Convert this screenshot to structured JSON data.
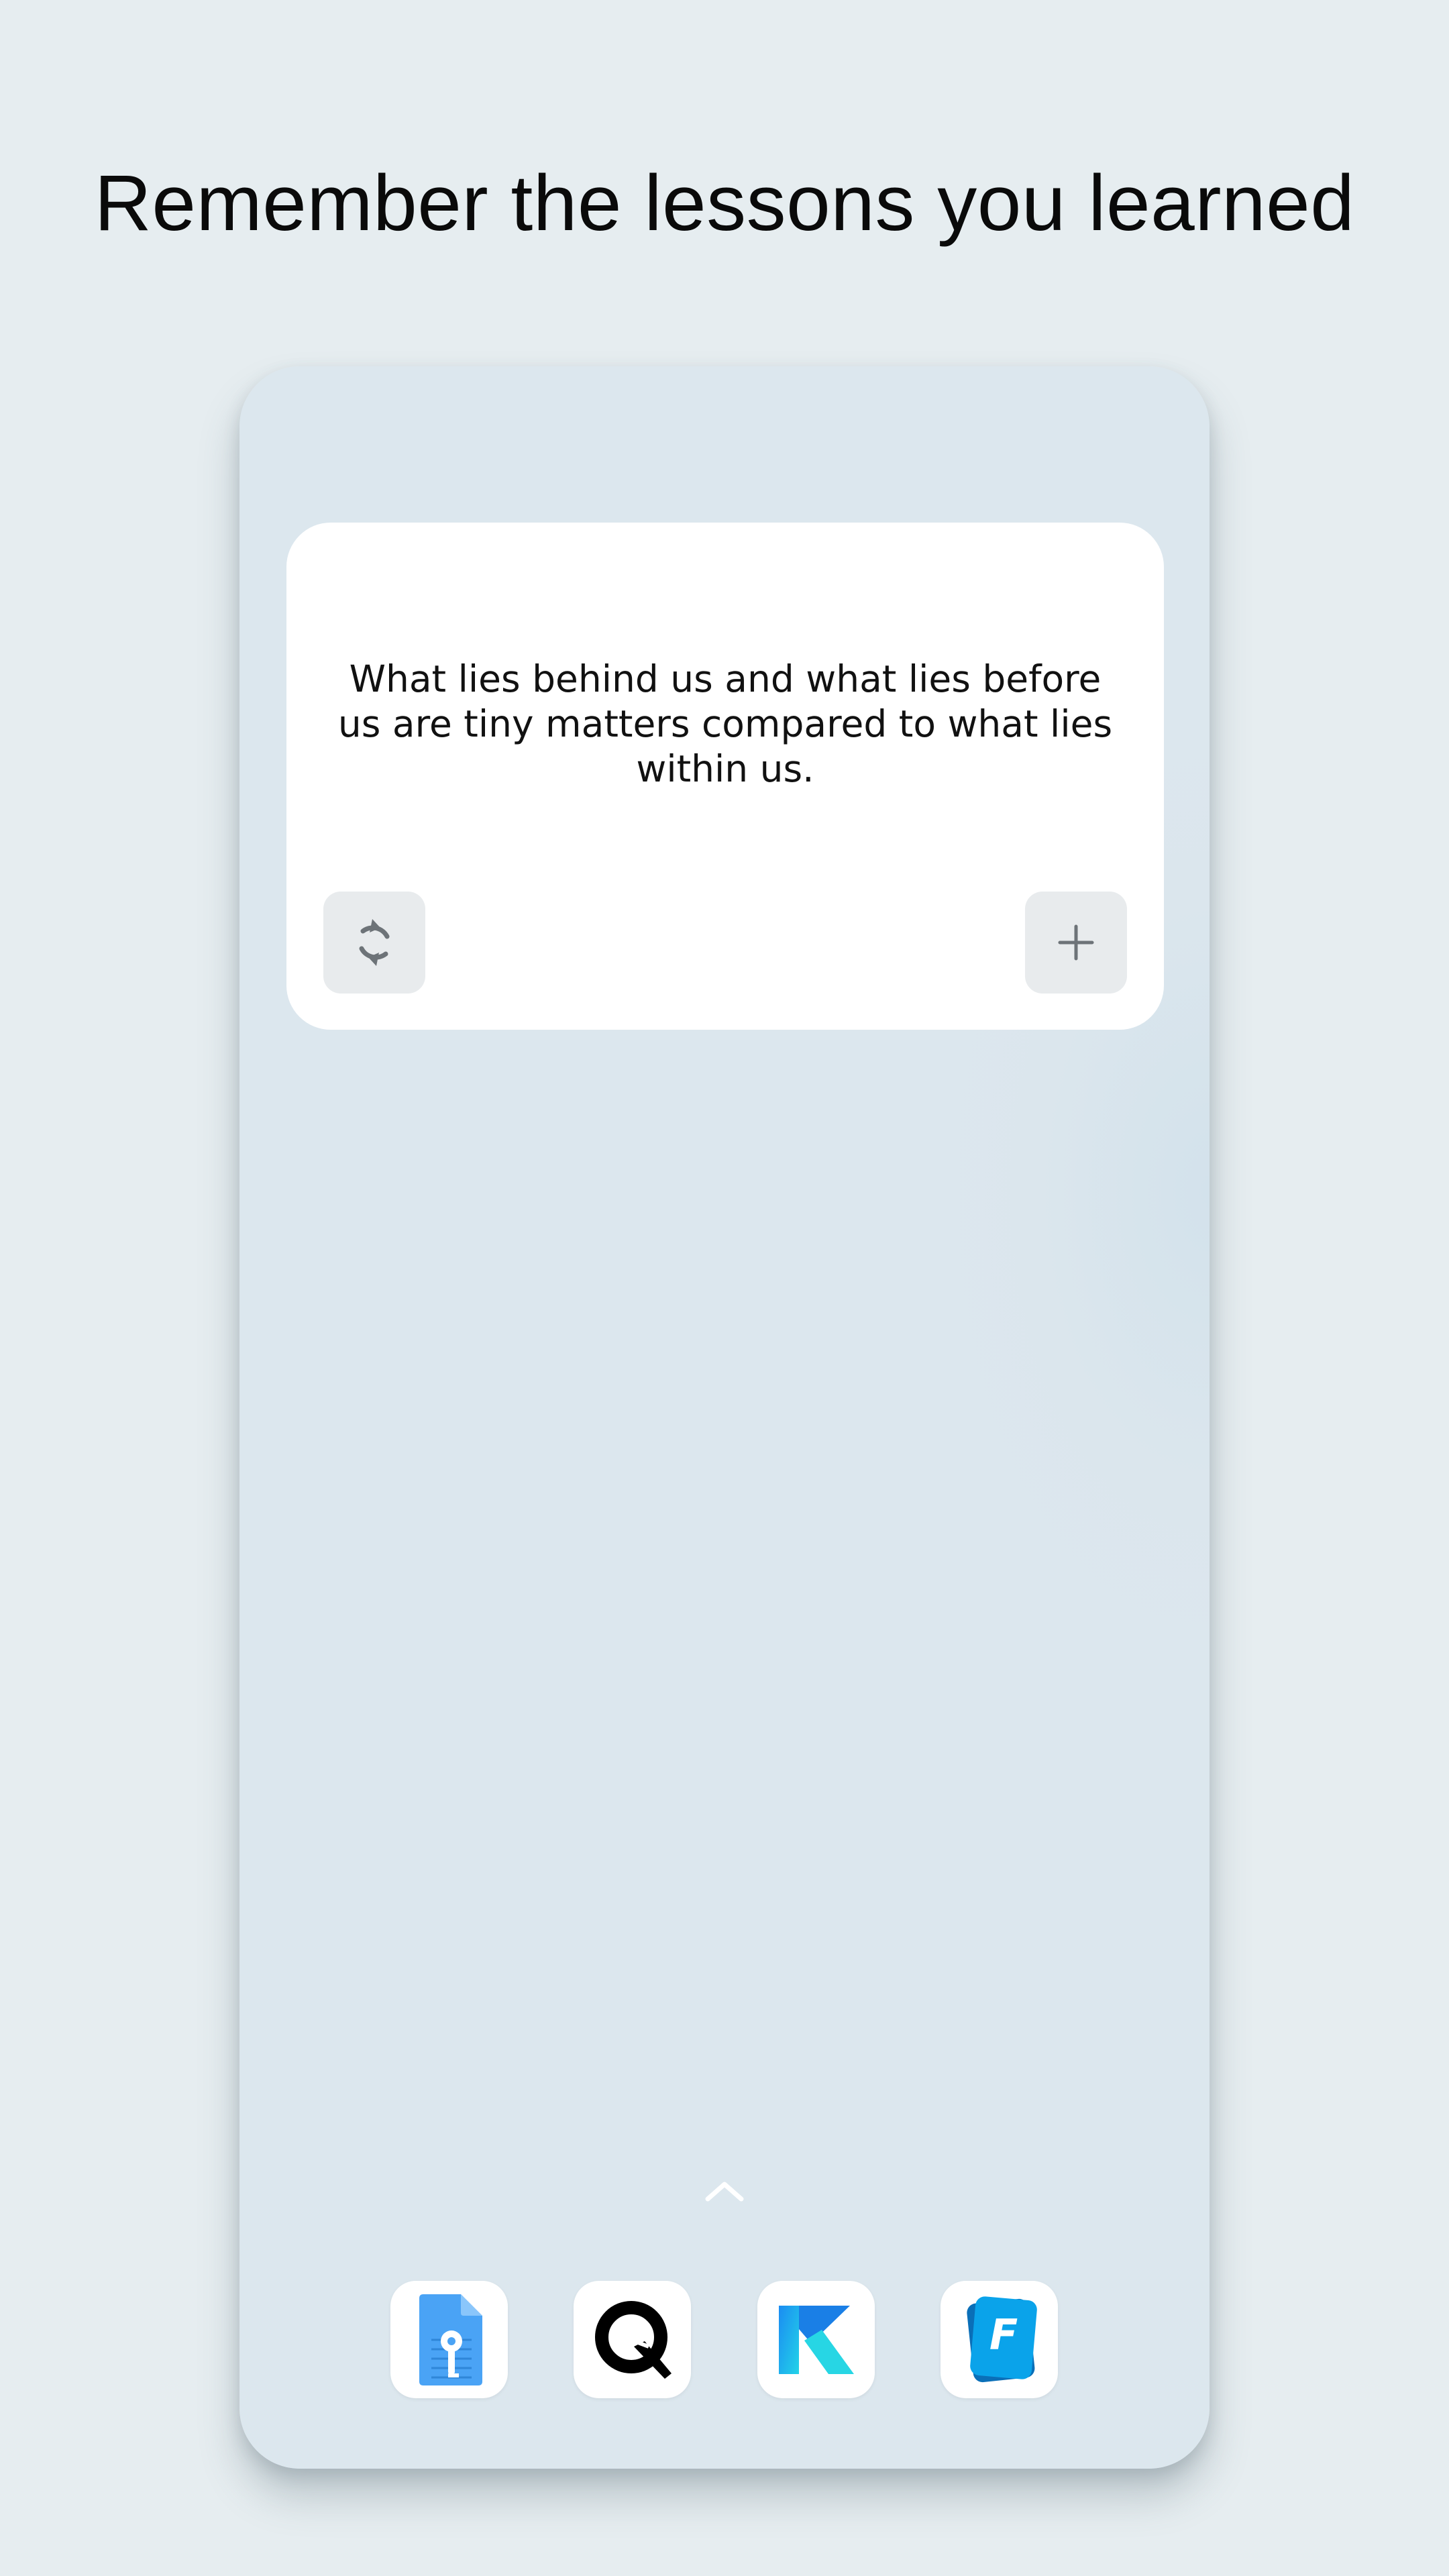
{
  "headline": "Remember the lessons you learned",
  "widget": {
    "quote": "What lies behind us and what lies before us are tiny matters compared to what lies within us.",
    "refresh_icon": "refresh-icon",
    "add_icon": "plus-icon"
  },
  "home": {
    "app_drawer_icon": "chevron-up-icon",
    "dock_apps": [
      {
        "icon": "document-key-app-icon",
        "color": "#4aa3f5"
      },
      {
        "icon": "q-logo-app-icon",
        "color": "#000000"
      },
      {
        "icon": "k-logo-app-icon",
        "color": "#1fb6f0"
      },
      {
        "icon": "flashcard-f-app-icon",
        "color": "#0a9fe8"
      }
    ]
  },
  "colors": {
    "background": "#e6edf0",
    "phone_screen": "#dce7ee",
    "widget_bg": "#ffffff",
    "button_bg": "#e8ebed",
    "button_icon": "#6d7378"
  }
}
